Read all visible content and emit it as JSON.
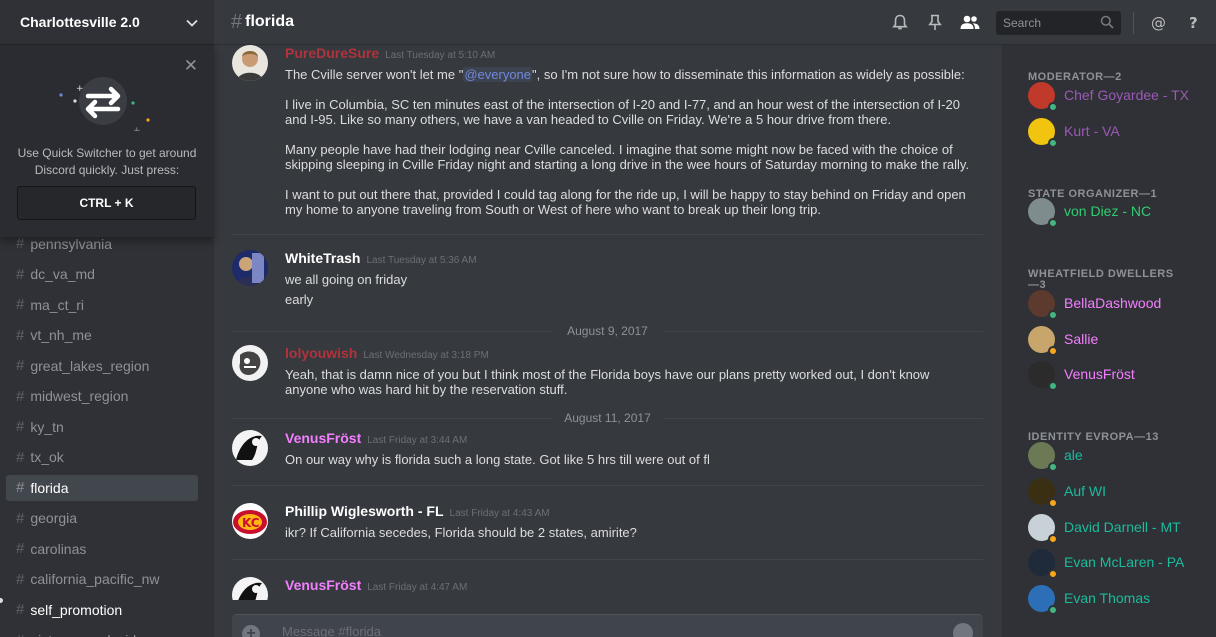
{
  "server": {
    "name": "Charlottesville 2.0"
  },
  "quick_switcher": {
    "tip": "Use Quick Switcher to get around Discord quickly. Just press:",
    "shortcut": "CTRL + K"
  },
  "channels": [
    {
      "name": "pennsylvania"
    },
    {
      "name": "dc_va_md"
    },
    {
      "name": "ma_ct_ri"
    },
    {
      "name": "vt_nh_me"
    },
    {
      "name": "great_lakes_region"
    },
    {
      "name": "midwest_region"
    },
    {
      "name": "ky_tn"
    },
    {
      "name": "tx_ok"
    },
    {
      "name": "florida",
      "active": true
    },
    {
      "name": "georgia"
    },
    {
      "name": "carolinas"
    },
    {
      "name": "california_pacific_nw"
    },
    {
      "name": "self_promotion",
      "unread": true
    },
    {
      "name": "pictures_and_video"
    }
  ],
  "header": {
    "channel": "florida",
    "search_placeholder": "Search"
  },
  "messages": [
    {
      "author": "PureDureSure",
      "color": "#b0333d",
      "timestamp": "Last Tuesday at 5:10 AM",
      "paragraphs": [
        {
          "pre": "The  Cville server won't let me \"",
          "mention": "@everyone",
          "post": "\", so I'm not sure how to disseminate this information as widely as possible:"
        },
        {
          "text": "I live in Columbia, SC ten minutes east of the intersection of I-20 and I-77, and an hour west of the intersection of I-20 and I-95. Like so many others, we have a van headed to Cville on Friday. We're a 5 hour drive from there."
        },
        {
          "text": "Many people have had their lodging near Cville canceled. I imagine that some might now be faced with the choice of skipping sleeping in Cville Friday night and starting a long drive in the wee hours of Saturday morning to make the rally."
        },
        {
          "text": "I want to put out there that, provided I could tag along for the ride up, I will be happy to stay behind on Friday and open my home to anyone traveling from South or West of here who want to break up their long trip."
        }
      ]
    },
    {
      "author": "WhiteTrash",
      "color": "#ffffff",
      "timestamp": "Last Tuesday at 5:36 AM",
      "lines": [
        "we all going on friday",
        "early"
      ]
    },
    {
      "date_divider": "August 9, 2017"
    },
    {
      "author": "lolyouwish",
      "color": "#b0333d",
      "timestamp": "Last Wednesday at 3:18 PM",
      "lines": [
        "Yeah, that is damn nice of you but I think most of the Florida boys have our plans pretty worked out, I don't know anyone who was hard hit by the reservation stuff."
      ]
    },
    {
      "date_divider": "August 11, 2017"
    },
    {
      "author": "VenusFröst",
      "color": "#f47fff",
      "timestamp": "Last Friday at 3:44 AM",
      "lines": [
        "On our way why is florida such a long state. Got like 5 hrs till were out of fl"
      ]
    },
    {
      "author": "Phillip Wiglesworth - FL",
      "color": "#ffffff",
      "timestamp": "Last Friday at 4:43 AM",
      "lines": [
        "ikr?  If California secedes, Florida should be 2 states, amirite?"
      ]
    },
    {
      "author": "VenusFröst",
      "color": "#f47fff",
      "timestamp": "Last Friday at 4:47 AM",
      "lines": []
    }
  ],
  "composer": {
    "placeholder": "Message #florida"
  },
  "members": {
    "groups": [
      {
        "role": "MODERATOR—2",
        "members": [
          {
            "name": "Chef Goyardee - TX",
            "color": "#9b59b6",
            "status": "online",
            "avatar": "#c0392b"
          },
          {
            "name": "Kurt - VA",
            "color": "#9b59b6",
            "status": "online",
            "avatar": "#f1c40f"
          }
        ]
      },
      {
        "role": "STATE ORGANIZER—1",
        "members": [
          {
            "name": "von Diez - NC",
            "color": "#2ecc71",
            "status": "online",
            "avatar": "#7f8c8d"
          }
        ]
      },
      {
        "role": "WHEATFIELD DWELLERS—3",
        "members": [
          {
            "name": "BellaDashwood",
            "color": "#f47fff",
            "status": "online",
            "avatar": "#5d3a2e"
          },
          {
            "name": "Sallie",
            "color": "#f47fff",
            "status": "idle",
            "avatar": "#c8a66b"
          },
          {
            "name": "VenusFröst",
            "color": "#f47fff",
            "status": "online",
            "avatar": "#2b2b2b"
          }
        ]
      },
      {
        "role": "IDENTITY EVROPA—13",
        "members": [
          {
            "name": "ale",
            "color": "#1abc9c",
            "status": "online",
            "avatar": "#6b7a55"
          },
          {
            "name": "Auf WI",
            "color": "#1abc9c",
            "status": "idle",
            "avatar": "#3a2f12"
          },
          {
            "name": "David Darnell - MT",
            "color": "#1abc9c",
            "status": "idle",
            "avatar": "#c9d1d8"
          },
          {
            "name": "Evan McLaren - PA",
            "color": "#1abc9c",
            "status": "idle",
            "avatar": "#1f2a3a"
          },
          {
            "name": "Evan Thomas",
            "color": "#1abc9c",
            "status": "online",
            "avatar": "#2c6fb7"
          }
        ]
      }
    ]
  }
}
